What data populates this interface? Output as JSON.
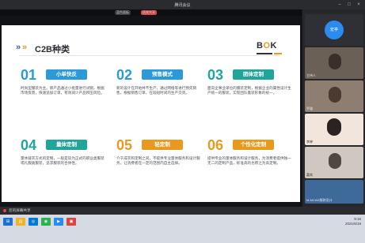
{
  "window": {
    "title": "腾讯会议"
  },
  "top_strip": {
    "chip1": "蓝色面板",
    "chip2": "结束共享"
  },
  "slide": {
    "title": "C2B种类",
    "logo": {
      "left": "B",
      "middle": "O",
      "right": "K"
    },
    "cards": [
      {
        "num": "01",
        "label": "小单快反",
        "desc": "时尚型服装为主。新产品通过小批量进行试销，根据市场反馈，快速追加订单，有效减少产品积压风险。",
        "color": "#2b9ad6"
      },
      {
        "num": "02",
        "label": "预售模式",
        "desc": "新的设计在开始并不生产，通过网络等进行预先销售，根据销售订单，在较短时间内生产交货。",
        "color": "#2b9ad6"
      },
      {
        "num": "03",
        "label": "团体定制",
        "desc": "面向企事业单位的服装定制，根据企业的属性设计生产统一的服装，实现团队着装形象的统一。",
        "color": "#21a49a"
      },
      {
        "num": "04",
        "label": "量体定制",
        "desc": "量体裁衣方式的定制，一般是较为正式的职业类服装或礼服类服装，追求服装的合体性。",
        "color": "#21a49a"
      },
      {
        "num": "05",
        "label": "轻定制",
        "desc": "介于成衣和定制之间，不提供专业量体服务和设计服务，让消费者在一定的范围内自主选择。",
        "color": "#e89a1f"
      },
      {
        "num": "06",
        "label": "个性化定制",
        "desc": "提供专业的量体服务和设计服务，为消费者提供独一无二的定制产品，标准高的也称之为高定制。",
        "color": "#e89a1f"
      }
    ]
  },
  "participants": [
    {
      "name": "宏亭",
      "bg": "#2b8cf0"
    },
    {
      "name": "主持人",
      "bg": "#4a4c52"
    },
    {
      "name": "罗璇",
      "bg": "#5c4a44"
    },
    {
      "name": "李婷",
      "bg": "#c73f3f"
    },
    {
      "name": "嘉宾",
      "bg": "#8a7f77"
    },
    {
      "name": "M-MCAD服装设计",
      "bg": "#3e6a9a"
    },
    {
      "name": "张丹",
      "bg": "#ffffff"
    }
  ],
  "bottombar": {
    "label": "您的屏幕共享"
  },
  "taskbar": {
    "time": "9:16",
    "date": "2021/6/19"
  }
}
